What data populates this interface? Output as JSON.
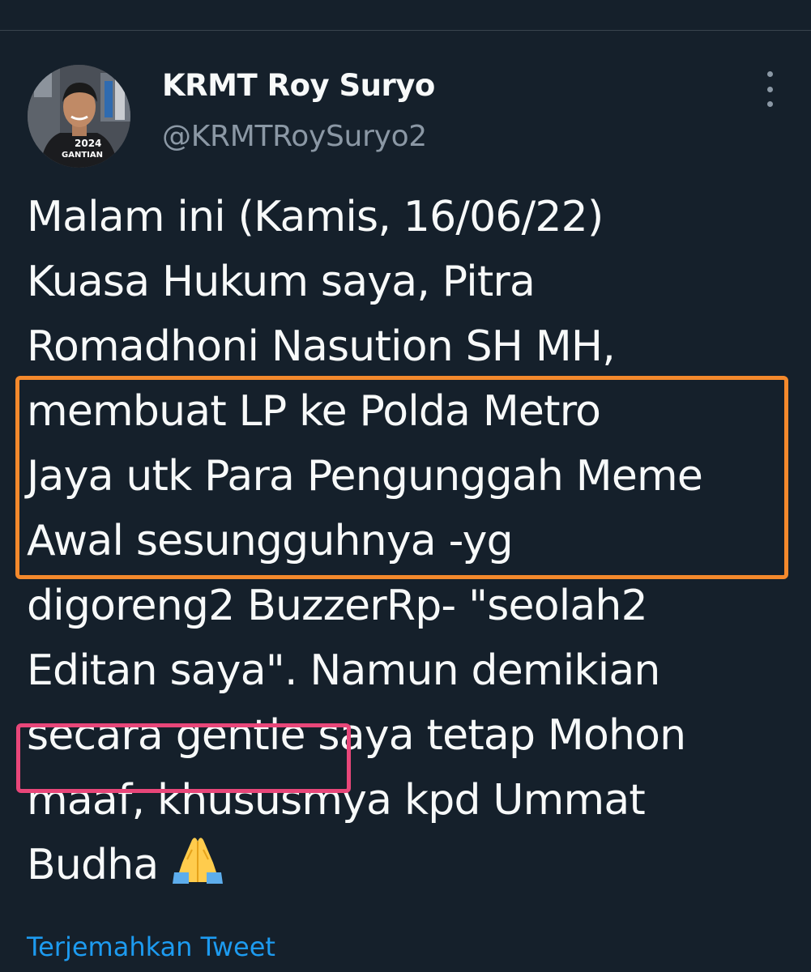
{
  "user": {
    "display_name": "KRMT Roy Suryo",
    "handle": "@KRMTRoySuryo2",
    "avatar_shirt_text_1": "2024",
    "avatar_shirt_text_2": "GANTIAN"
  },
  "tweet": {
    "lines": [
      "Malam ini (Kamis, 16/06/22)",
      "Kuasa Hukum saya, Pitra",
      "Romadhoni Nasution SH MH,",
      "membuat LP ke Polda Metro",
      "Jaya utk Para Pengunggah Meme",
      "Awal sesungguhnya -yg",
      "digoreng2 BuzzerRp- \"seolah2",
      "Editan saya\". Namun demikian",
      "secara gentle saya tetap Mohon",
      "maaf, khususmya kpd Ummat",
      "Budha"
    ],
    "emoji_icon": "folded-hands-icon"
  },
  "highlights": [
    {
      "color": "#f4892c",
      "covers": "membuat LP ke Polda Metro Jaya utk Para Pengunggah Meme Awal sesungguhnya -yg"
    },
    {
      "color": "#e84679",
      "covers": "secara gentle"
    }
  ],
  "translate_label": "Terjemahkan Tweet",
  "colors": {
    "background": "#15202b",
    "text": "#f7f9f9",
    "secondary_text": "#8b98a5",
    "link": "#1d9bf0"
  }
}
